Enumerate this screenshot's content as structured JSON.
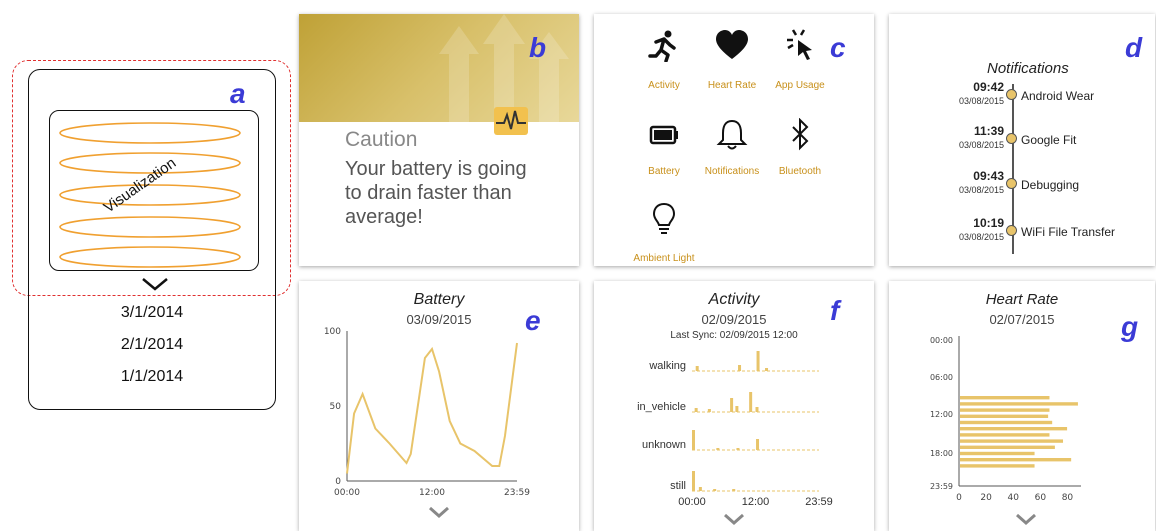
{
  "colors": {
    "accent": "#e8c46a",
    "orange": "#f0a030",
    "letter": "#3b3bd6",
    "dashed": "#e03030"
  },
  "panel_a": {
    "letter": "a",
    "viz_label": "Visualization",
    "dates": [
      "3/1/2014",
      "2/1/2014",
      "1/1/2014"
    ]
  },
  "panel_b": {
    "letter": "b",
    "caution_title": "Caution",
    "message": "Your battery is going to drain faster than average!"
  },
  "panel_c": {
    "letter": "c",
    "apps": [
      {
        "label": "Activity",
        "icon": "running-person-icon"
      },
      {
        "label": "Heart Rate",
        "icon": "heart-icon"
      },
      {
        "label": "App Usage",
        "icon": "cursor-click-icon"
      },
      {
        "label": "Battery",
        "icon": "battery-icon"
      },
      {
        "label": "Notifications",
        "icon": "bell-icon"
      },
      {
        "label": "Bluetooth",
        "icon": "bluetooth-icon"
      },
      {
        "label": "Ambient Light",
        "icon": "lightbulb-icon"
      }
    ]
  },
  "panel_d": {
    "letter": "d",
    "title": "Notifications",
    "items": [
      {
        "time": "09:42",
        "date": "03/08/2015",
        "label": "Android Wear"
      },
      {
        "time": "11:39",
        "date": "03/08/2015",
        "label": "Google Fit"
      },
      {
        "time": "09:43",
        "date": "03/08/2015",
        "label": "Debugging"
      },
      {
        "time": "10:19",
        "date": "03/08/2015",
        "label": "WiFi File Transfer"
      }
    ]
  },
  "panel_e": {
    "letter": "e",
    "title": "Battery",
    "date": "03/09/2015"
  },
  "panel_f": {
    "letter": "f",
    "title": "Activity",
    "date": "02/09/2015",
    "sync": "Last Sync: 02/09/2015 12:00"
  },
  "panel_g": {
    "letter": "g",
    "title": "Heart Rate",
    "date": "02/07/2015"
  },
  "chart_data": [
    {
      "type": "line",
      "y_ticks": [
        "0",
        "50",
        "100"
      ],
      "x_ticks": [
        "00:00",
        "12:00",
        "23:59"
      ],
      "ylim": [
        0,
        100
      ],
      "x": [
        0,
        1,
        2.2,
        4,
        6,
        8.4,
        9,
        11,
        12,
        13,
        14.5,
        16,
        18,
        20.5,
        21.5,
        22.3,
        24
      ],
      "values": [
        5,
        45,
        58,
        35,
        25,
        12,
        18,
        82,
        88,
        73,
        40,
        25,
        20,
        10,
        10,
        30,
        92
      ]
    },
    {
      "type": "bar",
      "categories": [
        "walking",
        "in_vehicle",
        "unknown",
        "still"
      ],
      "x_ticks": [
        "00:00",
        "12:00",
        "23:59"
      ],
      "series": [
        {
          "values": [
            [
              0.7,
              0.25
            ],
            [
              8.7,
              0.3
            ],
            [
              12.2,
              1.0
            ],
            [
              13.8,
              0.15
            ]
          ]
        },
        {
          "values": [
            [
              0.5,
              0.2
            ],
            [
              3,
              0.15
            ],
            [
              7.2,
              0.7
            ],
            [
              8.2,
              0.3
            ],
            [
              10.8,
              1.0
            ],
            [
              12,
              0.25
            ]
          ]
        },
        {
          "values": [
            [
              0.0,
              1.0
            ],
            [
              4.6,
              0.1
            ],
            [
              8.4,
              0.1
            ],
            [
              12.1,
              0.55
            ]
          ]
        },
        {
          "values": [
            [
              0.0,
              1.0
            ],
            [
              1.3,
              0.2
            ],
            [
              4.0,
              0.1
            ],
            [
              7.6,
              0.1
            ]
          ]
        }
      ]
    },
    {
      "type": "bar",
      "orientation": "horizontal",
      "y_ticks": [
        "00:00",
        "06:00",
        "12:00",
        "18:00",
        "23:59"
      ],
      "x_ticks": [
        "0",
        "20",
        "40",
        "60",
        "80"
      ],
      "xlim": [
        0,
        90
      ],
      "values": [
        66,
        87,
        66,
        65,
        68,
        79,
        66,
        76,
        70,
        55,
        82,
        55
      ]
    }
  ]
}
